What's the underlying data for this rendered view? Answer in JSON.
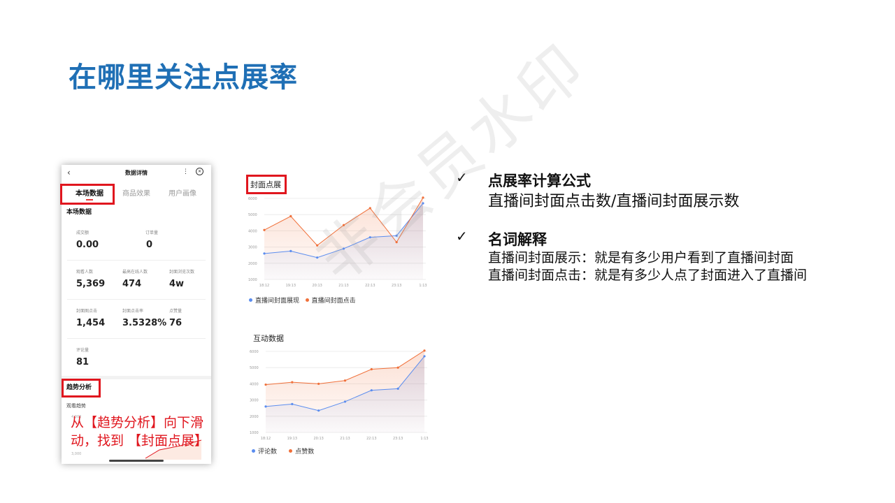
{
  "title": "在哪里关注点展率",
  "phone": {
    "header_title": "数据详情",
    "tabs": [
      "本场数据",
      "商品效果",
      "用户画像"
    ],
    "section1": "本场数据",
    "metrics": [
      {
        "label": "成交额",
        "value": "0.00"
      },
      {
        "label": "订单量",
        "value": "0"
      },
      {
        "label": "观看人数",
        "value": "5,369"
      },
      {
        "label": "最高在线人数",
        "value": "474"
      },
      {
        "label": "封面浏览次数",
        "value": "4w"
      },
      {
        "label": "封面图点击",
        "value": "1,454"
      },
      {
        "label": "封面点击率",
        "value": "3.5328%"
      },
      {
        "label": "点赞量",
        "value": "76"
      },
      {
        "label": "评论量",
        "value": "81"
      }
    ],
    "section2": "趋势分析",
    "trend_label": "观看趋势",
    "axis_small": [
      "4,000",
      "3,000"
    ]
  },
  "note": [
    "从【趋势分析】向下滑",
    "动，找到 【封面点展】"
  ],
  "chart_data": [
    {
      "type": "area",
      "title": "封面点展",
      "x": [
        "18:12",
        "19:13",
        "20:13",
        "21:13",
        "22:13",
        "23:13",
        "1:13"
      ],
      "ylim": [
        1000,
        6000
      ],
      "yticks": [
        "6000",
        "5000",
        "4000",
        "3000",
        "2000",
        "1000"
      ],
      "series": [
        {
          "name": "直播间封面展现",
          "color": "#5b8def",
          "values": [
            2600,
            2750,
            2350,
            2900,
            3600,
            3700,
            5700
          ]
        },
        {
          "name": "直播间封面点击",
          "color": "#f0703a",
          "values": [
            4050,
            4900,
            3100,
            4350,
            5400,
            3300,
            6050
          ]
        }
      ]
    },
    {
      "type": "area",
      "title": "互动数据",
      "x": [
        "18:12",
        "19:13",
        "20:13",
        "21:13",
        "22:13",
        "23:13",
        "1:13"
      ],
      "ylim": [
        1000,
        6000
      ],
      "yticks": [
        "6000",
        "5000",
        "4000",
        "3000",
        "2000",
        "1000"
      ],
      "series": [
        {
          "name": "评论数",
          "color": "#5b8def",
          "values": [
            2600,
            2750,
            2350,
            2900,
            3600,
            3700,
            5700
          ]
        },
        {
          "name": "点赞数",
          "color": "#f0703a",
          "values": [
            3950,
            4100,
            4000,
            4200,
            4900,
            5000,
            6050
          ]
        }
      ]
    }
  ],
  "right": {
    "check": "✓",
    "h1": "点展率计算公式",
    "formula": "直播间封面点击数/直播间封面展示数",
    "h2": "名词解释",
    "def1": "直播间封面展示：就是有多少用户看到了直播间封面",
    "def2": "直播间封面点击：就是有多少人点了封面进入了直播间"
  },
  "watermark": "非会员水印"
}
